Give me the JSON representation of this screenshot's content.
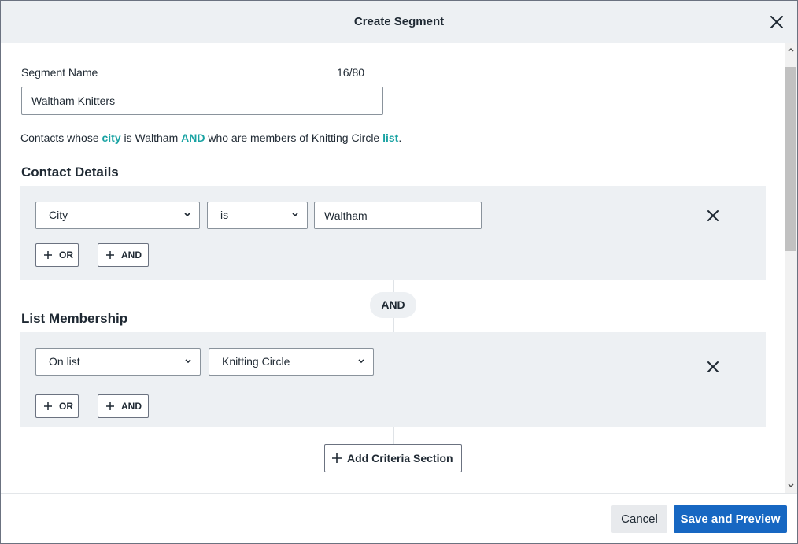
{
  "modal": {
    "title": "Create Segment",
    "close_icon": "close-icon"
  },
  "segment_name": {
    "label": "Segment Name",
    "count": "16/80",
    "value": "Waltham Knitters"
  },
  "summary": {
    "prefix": "Contacts whose ",
    "field": "city",
    "middle": " is Waltham ",
    "operator": "AND",
    "suffix": " who are members of Knitting Circle ",
    "list_word": "list",
    "end": "."
  },
  "sections": [
    {
      "title": "Contact Details",
      "field_select": "City",
      "operator_select": "is",
      "value_input": "Waltham",
      "or_label": "OR",
      "and_label": "AND"
    },
    {
      "title": "List Membership",
      "field_select": "On list",
      "value_select": "Knitting Circle",
      "or_label": "OR",
      "and_label": "AND"
    }
  ],
  "connector_label": "AND",
  "add_criteria_label": "Add Criteria Section",
  "footer": {
    "cancel_label": "Cancel",
    "save_label": "Save and Preview"
  },
  "colors": {
    "accent_teal": "#1aa3a3",
    "primary_blue": "#1767c2",
    "panel_gray": "#edf0f3"
  }
}
